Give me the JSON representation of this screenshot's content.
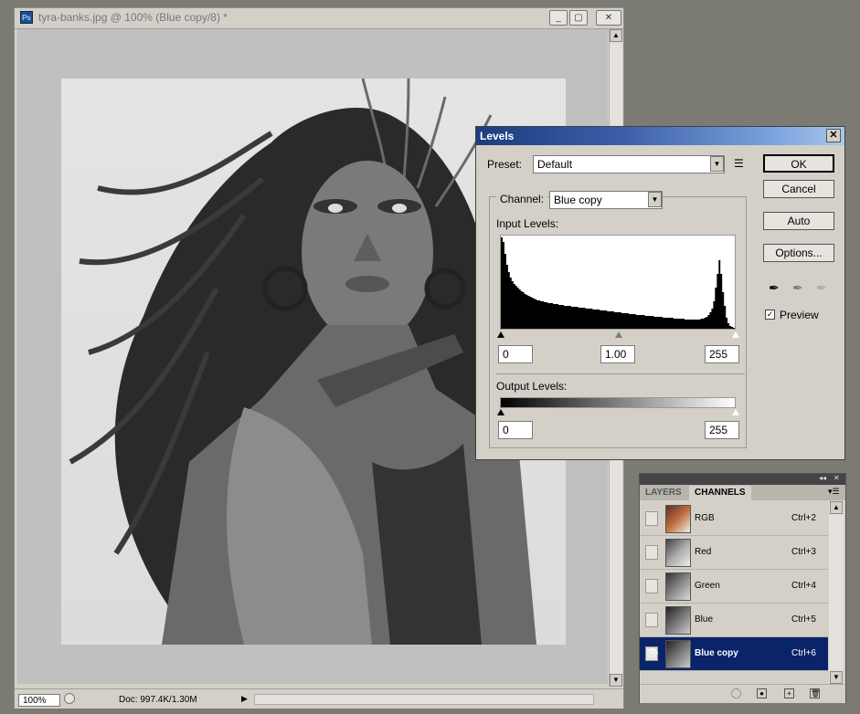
{
  "document": {
    "title": "tyra-banks.jpg @ 100% (Blue copy/8) *",
    "app_icon": "Ps",
    "zoom": "100%",
    "doc_info": "Doc: 997.4K/1.30M"
  },
  "levels": {
    "title": "Levels",
    "preset_label": "Preset:",
    "preset_value": "Default",
    "channel_label": "Channel:",
    "channel_value": "Blue copy",
    "input_levels_label": "Input Levels:",
    "input_black": "0",
    "input_gamma": "1.00",
    "input_white": "255",
    "output_levels_label": "Output Levels:",
    "output_black": "0",
    "output_white": "255",
    "buttons": {
      "ok": "OK",
      "cancel": "Cancel",
      "auto": "Auto",
      "options": "Options..."
    },
    "preview_label": "Preview",
    "preview_checked": true,
    "histogram": [
      100,
      95,
      82,
      70,
      62,
      56,
      52,
      49,
      47,
      45,
      43,
      41,
      40,
      38,
      37,
      36,
      35,
      34,
      33,
      32,
      31,
      31,
      30,
      30,
      29,
      29,
      28,
      28,
      28,
      27,
      27,
      27,
      26,
      26,
      26,
      25,
      25,
      25,
      25,
      24,
      24,
      24,
      24,
      23,
      23,
      23,
      23,
      22,
      22,
      22,
      22,
      21,
      21,
      21,
      21,
      20,
      20,
      20,
      20,
      19,
      19,
      19,
      19,
      18,
      18,
      18,
      18,
      17,
      17,
      17,
      17,
      16,
      16,
      16,
      16,
      15,
      15,
      15,
      15,
      15,
      14,
      14,
      14,
      14,
      14,
      13,
      13,
      13,
      13,
      13,
      12,
      12,
      12,
      12,
      12,
      12,
      11,
      11,
      11,
      11,
      11,
      11,
      10,
      10,
      10,
      10,
      10,
      10,
      10,
      10,
      10,
      11,
      11,
      12,
      13,
      15,
      18,
      22,
      30,
      45,
      60,
      75,
      60,
      40,
      25,
      12,
      6,
      3,
      2,
      1
    ]
  },
  "channels_panel": {
    "tabs": [
      "LAYERS",
      "CHANNELS"
    ],
    "active_tab": "CHANNELS",
    "rows": [
      {
        "name": "RGB",
        "shortcut": "Ctrl+2",
        "visible": false,
        "selected": false
      },
      {
        "name": "Red",
        "shortcut": "Ctrl+3",
        "visible": false,
        "selected": false
      },
      {
        "name": "Green",
        "shortcut": "Ctrl+4",
        "visible": false,
        "selected": false
      },
      {
        "name": "Blue",
        "shortcut": "Ctrl+5",
        "visible": false,
        "selected": false
      },
      {
        "name": "Blue copy",
        "shortcut": "Ctrl+6",
        "visible": true,
        "selected": true
      }
    ]
  },
  "colors": {
    "selection": "#0a246a",
    "title_gradient_start": "#1d3c7e"
  }
}
